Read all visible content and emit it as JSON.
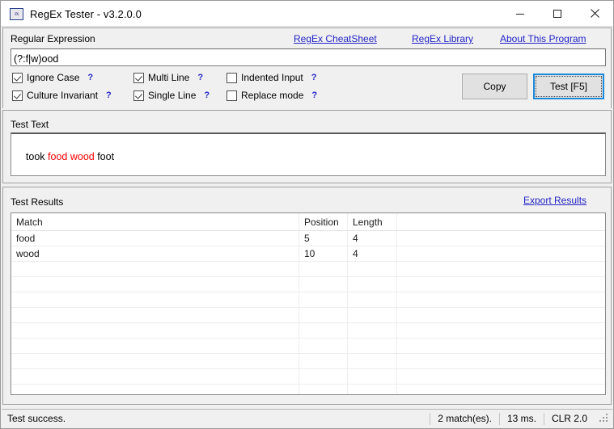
{
  "window": {
    "title": "RegEx Tester - v3.2.0.0",
    "icon": "regex-app-icon",
    "icon_text": "rx",
    "controls": {
      "minimize": "minimize-icon",
      "maximize": "maximize-icon",
      "close": "close-icon"
    }
  },
  "links": {
    "cheatsheet": "RegEx CheatSheet",
    "library": "RegEx Library",
    "about": "About This Program",
    "export": "Export Results"
  },
  "regex_section": {
    "label": "Regular Expression",
    "pattern": "(?:f|w)ood",
    "placeholder": "",
    "options": [
      {
        "label": "Ignore Case",
        "checked": true,
        "help": "?"
      },
      {
        "label": "Culture Invariant",
        "checked": true,
        "help": "?"
      },
      {
        "label": "Multi Line",
        "checked": true,
        "help": "?"
      },
      {
        "label": "Single Line",
        "checked": true,
        "help": "?"
      },
      {
        "label": "Indented Input",
        "checked": false,
        "help": "?"
      },
      {
        "label": "Replace mode",
        "checked": false,
        "help": "?"
      }
    ],
    "buttons": {
      "copy": "Copy",
      "test": "Test [F5]"
    }
  },
  "test_text_section": {
    "label": "Test Text",
    "parts": [
      {
        "text": "took ",
        "match": false
      },
      {
        "text": "food",
        "match": true
      },
      {
        "text": " ",
        "match": false
      },
      {
        "text": "wood",
        "match": true
      },
      {
        "text": " foot",
        "match": false
      }
    ],
    "full_text": "took food wood foot"
  },
  "results_section": {
    "label": "Test Results",
    "columns": [
      "Match",
      "Position",
      "Length"
    ],
    "rows": [
      {
        "match": "food",
        "position": "5",
        "length": "4"
      },
      {
        "match": "wood",
        "position": "10",
        "length": "4"
      }
    ],
    "empty_row_count": 9
  },
  "statusbar": {
    "message": "Test success.",
    "matches": "2 match(es).",
    "time": "13 ms.",
    "runtime": "CLR 2.0"
  },
  "colors": {
    "match_highlight": "#ff0000",
    "link": "#2424c8",
    "focus_border": "#1c8adb",
    "window_chrome": "#f0f0f0"
  }
}
